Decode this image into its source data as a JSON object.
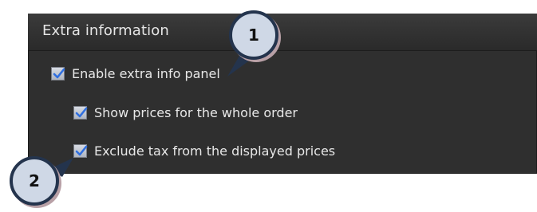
{
  "panel": {
    "title": "Extra information",
    "options": [
      {
        "label": "Enable extra info panel",
        "checked": true
      },
      {
        "label": "Show prices for the whole order",
        "checked": true
      },
      {
        "label": "Exclude tax from the displayed prices",
        "checked": true
      }
    ]
  },
  "callouts": [
    {
      "number": "1"
    },
    {
      "number": "2"
    }
  ],
  "colors": {
    "panel_bg": "#2f2f2f",
    "checkmark": "#2f6fe0",
    "callout_fill": "#cfd8e6",
    "callout_border": "#24344d"
  }
}
